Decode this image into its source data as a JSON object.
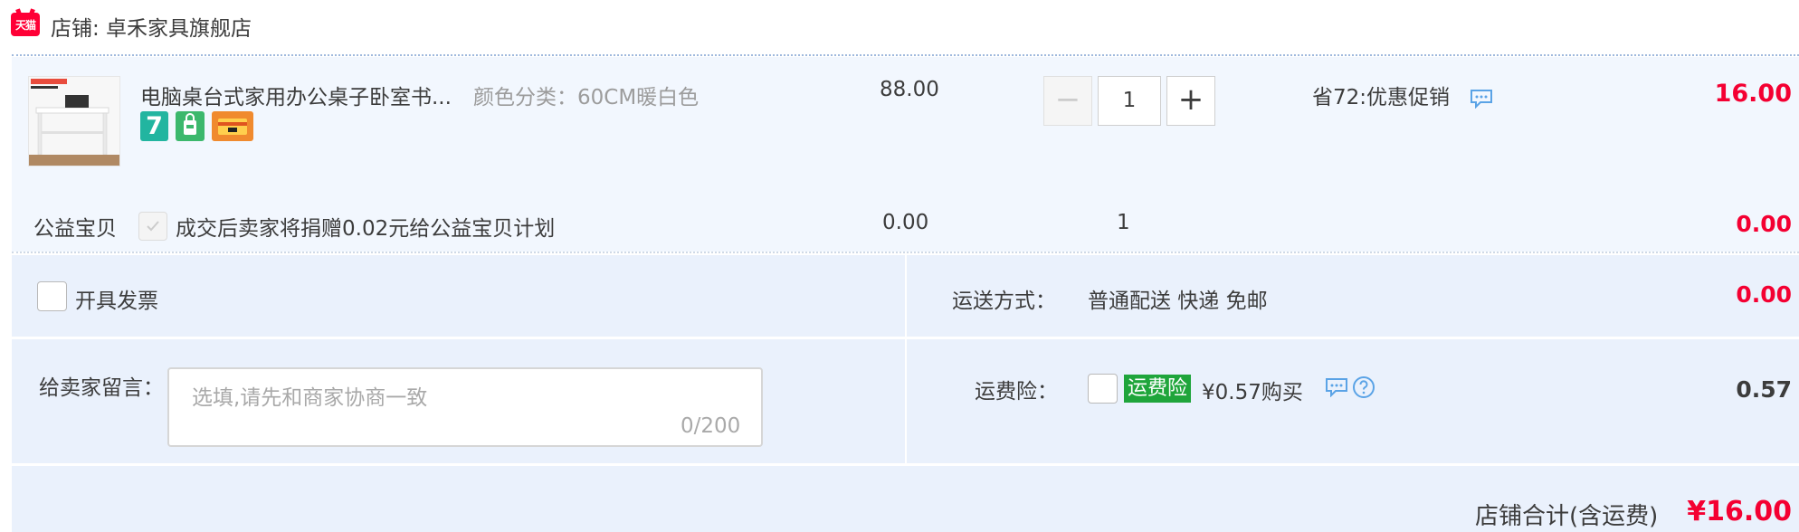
{
  "shop": {
    "badge": "天猫",
    "label": "店铺: 卓禾家具旗舰店"
  },
  "item": {
    "image_icon": "desk-product-image",
    "title": "电脑桌台式家用办公桌子卧室书...",
    "sku": "颜色分类：60CM暖白色",
    "tag_7day": "7",
    "unit_price": "88.00",
    "quantity": "1",
    "minus": "−",
    "plus": "+",
    "promotion": "省72:优惠促销",
    "total": "16.00"
  },
  "charity": {
    "label": "公益宝贝",
    "text": "成交后卖家将捐赠0.02元给公益宝贝计划",
    "price": "0.00",
    "quantity": "1",
    "total": "0.00"
  },
  "invoice": {
    "label": "开具发票"
  },
  "shipping": {
    "label": "运送方式：",
    "value": "普通配送 快递 免邮",
    "total": "0.00"
  },
  "message": {
    "label": "给卖家留言：",
    "placeholder": "选填,请先和商家协商一致",
    "counter": "0/200"
  },
  "insurance": {
    "label": "运费险：",
    "badge": "运费险",
    "price": "¥0.57购买",
    "total": "0.57"
  },
  "summary": {
    "label": "店铺合计(含运费)",
    "value": "¥16.00"
  },
  "colors": {
    "accent_red": "#f40032",
    "tmall_red": "#ff0036",
    "insurance_green": "#1fa53b",
    "light_blue_bg": "#eaf1fc"
  }
}
